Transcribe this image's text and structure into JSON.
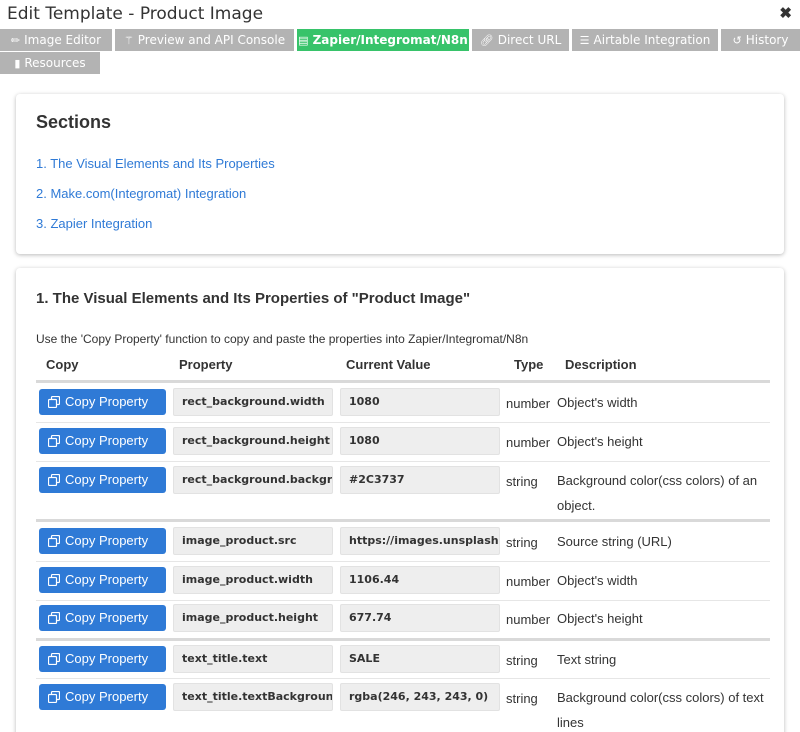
{
  "window": {
    "title": "Edit Template - Product Image",
    "close_label": "✖"
  },
  "tabs": [
    {
      "label": "Image Editor",
      "icon": "pencil-icon"
    },
    {
      "label": "Preview and API Console",
      "icon": "magic-wand-icon"
    },
    {
      "label": "Zapier/Integromat/N8n",
      "icon": "list-icon",
      "active": true
    },
    {
      "label": "Direct URL",
      "icon": "link-icon"
    },
    {
      "label": "Airtable Integration",
      "icon": "database-icon"
    },
    {
      "label": "History",
      "icon": "history-icon"
    },
    {
      "label": "Resources",
      "icon": "book-icon"
    }
  ],
  "sections": {
    "title": "Sections",
    "links": [
      "1. The Visual Elements and Its Properties",
      "2. Make.com(Integromat) Integration",
      "3. Zapier Integration"
    ]
  },
  "properties": {
    "title": "1. The Visual Elements and Its Properties of \"Product Image\"",
    "hint": "Use the 'Copy Property' function to copy and paste the properties into Zapier/Integromat/N8n",
    "headers": {
      "copy": "Copy",
      "property": "Property",
      "value": "Current Value",
      "type": "Type",
      "description": "Description"
    },
    "button_label": "Copy Property",
    "rows": [
      {
        "property": "rect_background.width",
        "value": "1080",
        "type": "number",
        "description": "Object's width"
      },
      {
        "property": "rect_background.height",
        "value": "1080",
        "type": "number",
        "description": "Object's height"
      },
      {
        "property": "rect_background.backgroun",
        "value": "#2C3737",
        "type": "string",
        "description": "Background color(css colors) of an object."
      },
      {
        "property": "image_product.src",
        "value": "https://images.unsplash.co",
        "type": "string",
        "description": "Source string (URL)"
      },
      {
        "property": "image_product.width",
        "value": "1106.44",
        "type": "number",
        "description": "Object's width"
      },
      {
        "property": "image_product.height",
        "value": "677.74",
        "type": "number",
        "description": "Object's height"
      },
      {
        "property": "text_title.text",
        "value": "SALE",
        "type": "string",
        "description": "Text string"
      },
      {
        "property": "text_title.textBackgroundCc",
        "value": "rgba(246, 243, 243, 0)",
        "type": "string",
        "description": "Background color(css colors) of text lines"
      }
    ]
  },
  "colors": {
    "accent": "#2f7ad6",
    "active_tab": "#37c36a",
    "tab": "#b3b3b3"
  }
}
